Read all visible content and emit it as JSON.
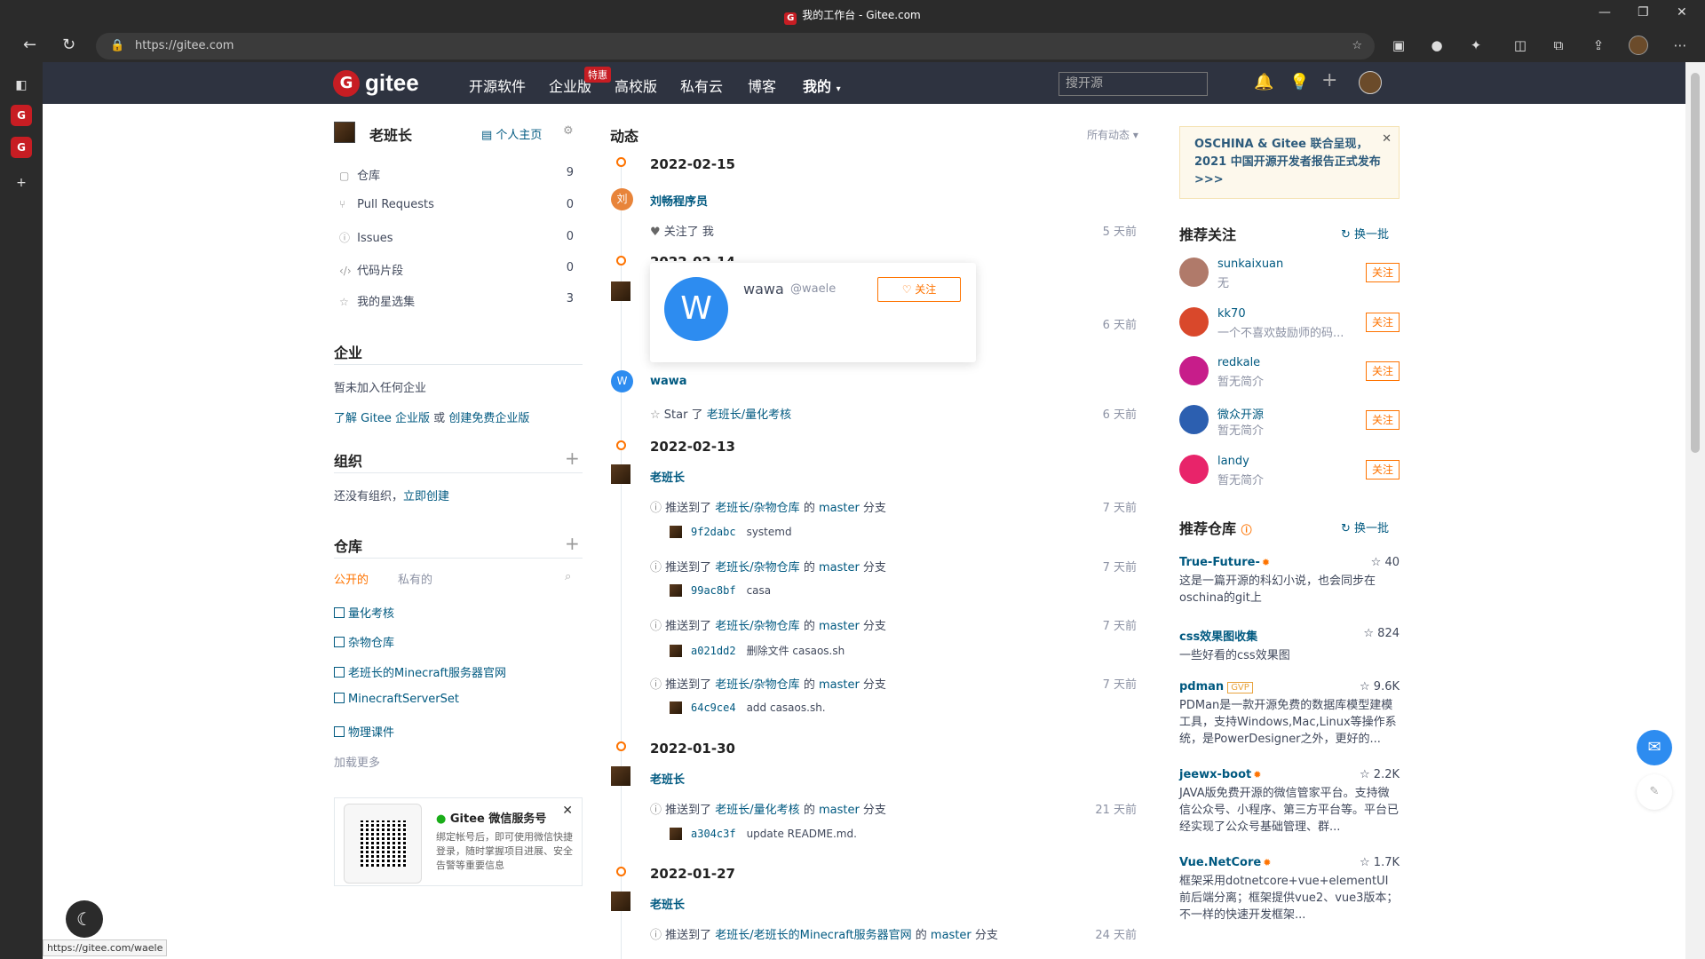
{
  "window": {
    "title": "我的工作台 - Gitee.com",
    "tab_logo": "G"
  },
  "address": {
    "url": "https://gitee.com"
  },
  "header": {
    "logo_text": "gitee",
    "logo_letter": "G",
    "nav": [
      "开源软件",
      "企业版",
      "高校版",
      "私有云",
      "博客",
      "我的"
    ],
    "badge": "特惠",
    "search_placeholder": "搜开源"
  },
  "user": {
    "name": "老班长",
    "home_link": "个人主页",
    "menu": [
      {
        "label": "仓库",
        "count": "9",
        "icon": "repo-icon"
      },
      {
        "label": "Pull Requests",
        "count": "0",
        "icon": "pr-icon"
      },
      {
        "label": "Issues",
        "count": "0",
        "icon": "issue-icon"
      },
      {
        "label": "代码片段",
        "count": "0",
        "icon": "code-icon"
      },
      {
        "label": "我的星选集",
        "count": "3",
        "icon": "star-icon"
      }
    ]
  },
  "enterprise": {
    "title": "企业",
    "empty": "暂未加入任何企业",
    "link1": "了解 Gitee 企业版",
    "or": " 或 ",
    "link2": "创建免费企业版"
  },
  "org": {
    "title": "组织",
    "empty": "还没有组织，",
    "create": "立即创建"
  },
  "repos": {
    "title": "仓库",
    "tab_public": "公开的",
    "tab_private": "私有的",
    "items": [
      "量化考核",
      "杂物仓库",
      "老班长的Minecraft服务器官网",
      "MinecraftServerSet",
      "物理课件"
    ],
    "more": "加载更多"
  },
  "wechat": {
    "title": "Gitee 微信服务号",
    "desc": "绑定帐号后，即可使用微信快捷登录，随时掌握项目进展、安全告警等重要信息"
  },
  "feed": {
    "title": "动态",
    "filter": "所有动态",
    "groups": [
      {
        "date": "2022-02-15"
      },
      {
        "date": "2022-02-14"
      },
      {
        "date": "2022-02-13"
      },
      {
        "date": "2022-01-30"
      },
      {
        "date": "2022-01-27"
      }
    ],
    "e1": {
      "user": "刘畅程序员",
      "avatar": "刘",
      "action": "关注了 我",
      "time": "5 天前"
    },
    "e2": {
      "time": "6 天前"
    },
    "e3": {
      "user": "wawa",
      "avatar": "W",
      "star": "Star 了 ",
      "repo": "老班长/量化考核",
      "time": "6 天前"
    },
    "e4_user": "老班长",
    "push_prefix": "推送到了 ",
    "push_mid": " 的 ",
    "push_branch": "master",
    "push_suffix": " 分支",
    "push_repo_zawu": "老班长/杂物仓库",
    "pushes": [
      {
        "sha": "9f2dabc",
        "msg": "systemd",
        "time": "7 天前"
      },
      {
        "sha": "99ac8bf",
        "msg": "casa",
        "time": "7 天前"
      },
      {
        "sha": "a021dd2",
        "msg": "删除文件 casaos.sh",
        "time": "7 天前"
      },
      {
        "sha": "64c9ce4",
        "msg": "add casaos.sh.",
        "time": "7 天前"
      }
    ],
    "e5": {
      "user": "老班长",
      "repo": "老班长/量化考核",
      "sha": "a304c3f",
      "msg": "update README.md.",
      "time": "21 天前"
    },
    "e6": {
      "user": "老班长",
      "repo": "老班长/老班长的Minecraft服务器官网",
      "time": "24 天前"
    }
  },
  "popup": {
    "avatar": "W",
    "name": "wawa",
    "handle": "@waele",
    "follow": "关注"
  },
  "banner": {
    "text": "OSCHINA & Gitee 联合呈现，2021 中国开源开发者报告正式发布 >>>"
  },
  "recommend": {
    "title": "推荐关注",
    "change": "换一批",
    "follow": "关注",
    "users": [
      {
        "name": "sunkaixuan",
        "desc": "无",
        "color": "#b07a6a"
      },
      {
        "name": "kk70",
        "desc": "一个不喜欢鼓励师的码...",
        "color": "#d9482b"
      },
      {
        "name": "redkale",
        "desc": "暂无简介",
        "color": "#c71d8a"
      },
      {
        "name": "微众开源",
        "desc": "暂无简介",
        "color": "#2c5fb0"
      },
      {
        "name": "landy",
        "desc": "暂无简介",
        "color": "#e8246a"
      }
    ]
  },
  "rrepos": {
    "title": "推荐仓库",
    "change": "换一批",
    "gvp": "GVP",
    "items": [
      {
        "name": "True-Future-",
        "stars": "40",
        "desc": "这是一篇开源的科幻小说，也会同步在oschina的git上"
      },
      {
        "name": "css效果图收集",
        "stars": "824",
        "desc": "一些好看的css效果图"
      },
      {
        "name": "pdman",
        "stars": "9.6K",
        "desc": "PDMan是一款开源免费的数据库模型建模工具，支持Windows,Mac,Linux等操作系统，是PowerDesigner之外，更好的..."
      },
      {
        "name": "jeewx-boot",
        "stars": "2.2K",
        "desc": "JAVA版免费开源的微信管家平台。支持微信公众号、小程序、第三方平台等。平台已经实现了公众号基础管理、群..."
      },
      {
        "name": "Vue.NetCore",
        "stars": "1.7K",
        "desc": "框架采用dotnetcore+vue+elementUI前后端分离；框架提供vue2、vue3版本；不一样的快速开发框架..."
      }
    ]
  },
  "status_url": "https://gitee.com/waele"
}
